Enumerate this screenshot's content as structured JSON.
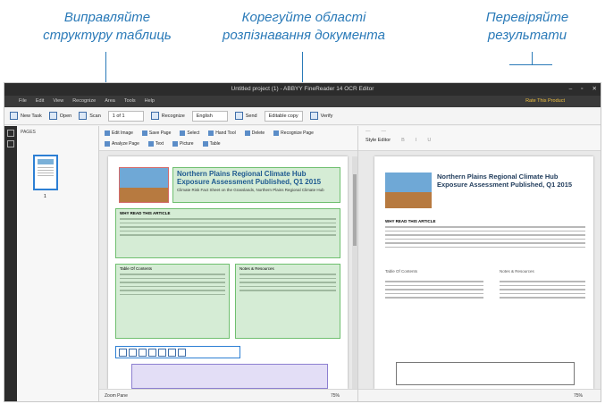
{
  "callouts": {
    "left_line1": "Виправляйте",
    "left_line2": "структуру таблиць",
    "center_line1": "Корегуйте області",
    "center_line2": "розпізнавання документа",
    "right_line1": "Перевіряйте",
    "right_line2": "результати"
  },
  "app": {
    "title": "Untitled project (1) - ABBYY FineReader 14 OCR Editor",
    "menu": [
      "File",
      "Edit",
      "View",
      "Recognize",
      "Area",
      "Tools",
      "Help"
    ],
    "buy_label": "Rate This Product",
    "toolbar": {
      "new_task": "New Task",
      "open": "Open",
      "scan": "Scan",
      "page_counter": "1 of 1",
      "recognize": "Recognize",
      "language": "English",
      "send": "Send",
      "copy_mode": "Editable copy",
      "verify": "Verify"
    },
    "pages_panel": {
      "header": "PAGES",
      "page_number": "1"
    },
    "image_toolbar": [
      "Edit Image",
      "Save Page",
      "Select",
      "Hand Tool",
      "Delete",
      "Recognize Page",
      "Analyze Page",
      "Text",
      "Picture",
      "Table"
    ],
    "document": {
      "title": "Northern Plains Regional Climate Hub Exposure Assessment Published, Q1 2015",
      "subtitle": "Climate Risk Fact Sheet on the Grasslands, Northern Plains Regional Climate Hub",
      "what_read": "WHY READ THIS ARTICLE",
      "toc_header": "Table Of Contents",
      "box_header": "Notes & Resources"
    },
    "text_toolbar": {
      "style_editor": "Style Editor"
    },
    "status_left": "Zoom Pane",
    "zoom_left": "75%",
    "zoom_right": "75%"
  }
}
